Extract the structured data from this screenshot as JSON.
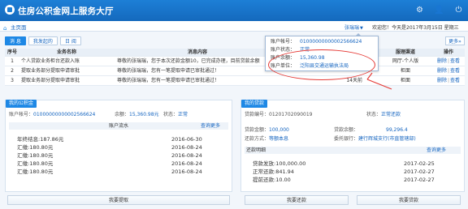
{
  "header": {
    "title": "住房公积金网上服务大厅",
    "icons": [
      "wrench-icon",
      "user-icon",
      "power-icon"
    ]
  },
  "crumb": {
    "home": "主页面",
    "user": "张瑞瑞",
    "welcome": "欢迎您！今天是2017年3月15日 星期三"
  },
  "tabs": {
    "items": [
      "消 息",
      "我发起的",
      "日 阅"
    ],
    "more": "更多»"
  },
  "messages": {
    "headers": {
      "no": "序号",
      "name": "业务名称",
      "content": "消息内容",
      "channel": "服理渠道",
      "op": "操作"
    },
    "rows": [
      {
        "no": "1",
        "name": "个人贷款业务柜台还款入账",
        "content": "尊敬的张瑞瑞，您于本次还款金额10，已完成办理，目前贷款余额",
        "time": "",
        "channel": "网厅-个人版",
        "del": "删除",
        "view": "查看"
      },
      {
        "no": "2",
        "name": "提取业务部分提取申请审批",
        "content": "尊敬的张瑞瑞，您有一笔提取申请已审批通过！",
        "time": "",
        "channel": "柜面",
        "del": "删除",
        "view": "查看"
      },
      {
        "no": "3",
        "name": "提取业务部分提取申请审批",
        "content": "尊敬的张瑞瑞，您有一笔提取申请已审批通过！",
        "time": "14天前",
        "channel": "柜面",
        "del": "删除",
        "view": "查看"
      }
    ]
  },
  "popover": {
    "account_label": "账户帐号：",
    "account": "01000000000002566624",
    "status_label": "账户状态：",
    "status": "正常",
    "balance_label": "账户余额：",
    "balance": "15,360.98",
    "unit_label": "账户单位：",
    "unit": "泛阳县交通运输执法局"
  },
  "fund": {
    "title": "我的公积金",
    "account_label": "账户帐号：",
    "account": "01000000000002566624",
    "balance_label": "余额：",
    "balance": "15,360.98元",
    "status_label": "状态：",
    "status": "正常",
    "flow_title": "账户流水",
    "flow_more": "查询更多",
    "flow": [
      {
        "desc": "年终结息:187.86元",
        "date": "2016-06-30"
      },
      {
        "desc": "汇缴:180.80元",
        "date": "2016-08-24"
      },
      {
        "desc": "汇缴:180.80元",
        "date": "2016-08-24"
      },
      {
        "desc": "汇缴:180.80元",
        "date": "2016-08-24"
      },
      {
        "desc": "汇缴:180.80元",
        "date": "2016-08-24"
      }
    ],
    "button": "我要提取"
  },
  "loan": {
    "title": "我的贷款",
    "no_label": "贷款编号：",
    "no": "01201702090019",
    "status_label": "状态：",
    "status": "正常还款",
    "amount_label": "贷款金额：",
    "amount": "100,000",
    "remain_label": "贷款余额：",
    "remain": "99,296.4",
    "method_label": "还款方式：",
    "method": "等额本息",
    "bank_label": "委托银行：",
    "bank": "建行辉城支行(市直管辖部)",
    "detail_title": "还款明细",
    "detail_more": "查询更多",
    "details": [
      {
        "desc": "贷款发放:100,000.00",
        "date": "2017-02-25"
      },
      {
        "desc": "正常还款:841.94",
        "date": "2017-02-27"
      },
      {
        "desc": "提前还款:10.00",
        "date": "2017-02-27"
      }
    ],
    "button_repay": "我要还款",
    "button_loan": "我要贷款"
  },
  "colors": {
    "brand": "#1e88e5",
    "header": "#1469bd",
    "highlight": "#e53935"
  }
}
